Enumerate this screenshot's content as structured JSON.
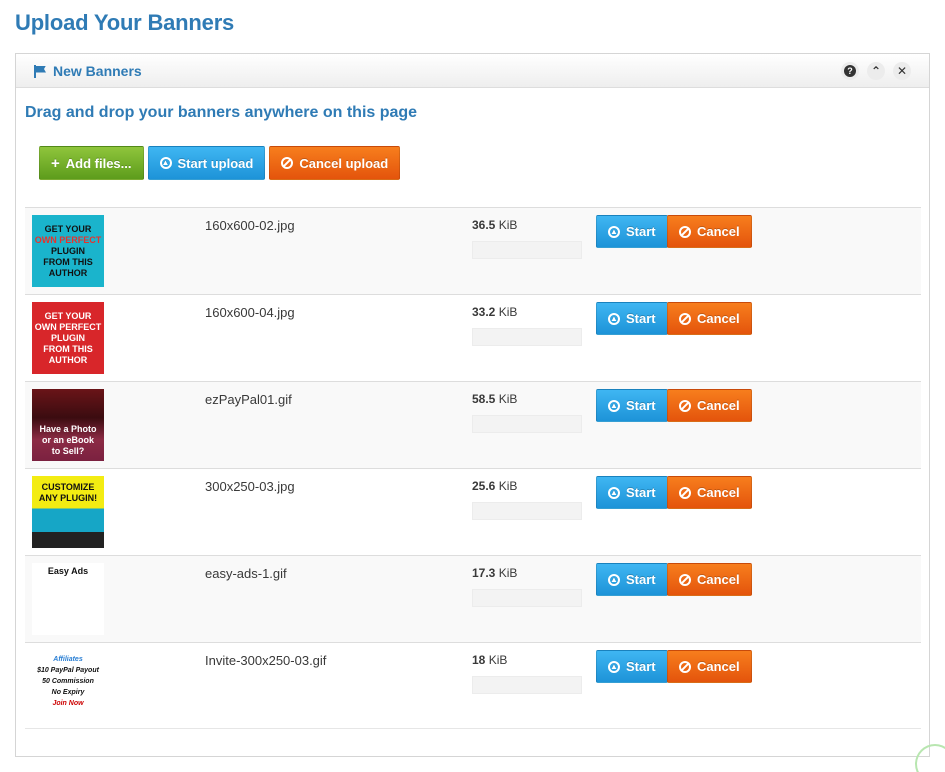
{
  "page": {
    "title": "Upload Your Banners"
  },
  "widget": {
    "title": "New Banners",
    "tools": {
      "help": "?",
      "collapse": "⌃",
      "close": "✕"
    }
  },
  "dropzone": {
    "hint": "Drag and drop your banners anywhere on this page"
  },
  "actions": {
    "add_label": "Add files...",
    "start_label": "Start upload",
    "cancel_label": "Cancel upload"
  },
  "files": [
    {
      "name": "160x600-02.jpg",
      "size_value": "36.5",
      "size_unit": "KiB",
      "start_label": "Start",
      "cancel_label": "Cancel",
      "progress": 0,
      "thumb_lines": [
        "GET YOUR",
        "OWN PERFECT",
        "PLUGIN",
        "FROM THIS",
        "AUTHOR"
      ]
    },
    {
      "name": "160x600-04.jpg",
      "size_value": "33.2",
      "size_unit": "KiB",
      "start_label": "Start",
      "cancel_label": "Cancel",
      "progress": 0,
      "thumb_lines": [
        "GET YOUR",
        "OWN PERFECT",
        "PLUGIN",
        "FROM THIS",
        "AUTHOR"
      ]
    },
    {
      "name": "ezPayPal01.gif",
      "size_value": "58.5",
      "size_unit": "KiB",
      "start_label": "Start",
      "cancel_label": "Cancel",
      "progress": 0,
      "thumb_lines": [
        "Have a Photo",
        "or an eBook",
        "to Sell?"
      ]
    },
    {
      "name": "300x250-03.jpg",
      "size_value": "25.6",
      "size_unit": "KiB",
      "start_label": "Start",
      "cancel_label": "Cancel",
      "progress": 0,
      "thumb_lines": [
        "CUSTOMIZE",
        "ANY PLUGIN!"
      ]
    },
    {
      "name": "easy-ads-1.gif",
      "size_value": "17.3",
      "size_unit": "KiB",
      "start_label": "Start",
      "cancel_label": "Cancel",
      "progress": 0,
      "thumb_lines": [
        "Easy Ads"
      ]
    },
    {
      "name": "Invite-300x250-03.gif",
      "size_value": "18",
      "size_unit": "KiB",
      "start_label": "Start",
      "cancel_label": "Cancel",
      "progress": 0,
      "thumb_lines": [
        "Affiliates",
        "$10 PayPal Payout",
        "50 Commission",
        "No Expiry",
        "Join Now"
      ]
    }
  ],
  "colors": {
    "accent": "#2f7bb5",
    "green": "#6aac2a",
    "blue": "#2aa3e6",
    "orange": "#ee6412"
  }
}
